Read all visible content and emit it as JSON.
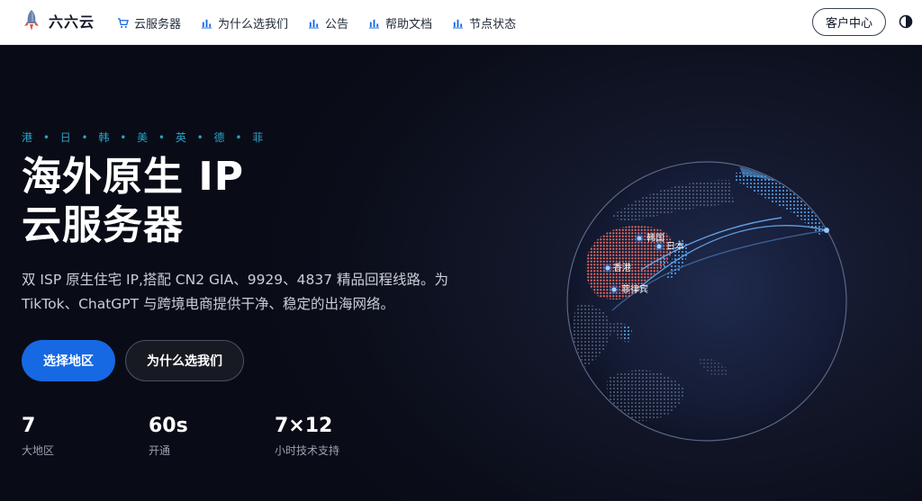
{
  "brand": {
    "name": "六六云",
    "icon": "rocket-icon"
  },
  "nav": [
    {
      "label": "云服务器",
      "icon": "cart-icon"
    },
    {
      "label": "为什么选我们",
      "icon": "bar-chart-icon"
    },
    {
      "label": "公告",
      "icon": "bar-chart-icon"
    },
    {
      "label": "帮助文档",
      "icon": "bar-chart-icon"
    },
    {
      "label": "节点状态",
      "icon": "bar-chart-icon"
    }
  ],
  "header": {
    "client_center": "客户中心",
    "theme_icon": "contrast-icon"
  },
  "hero": {
    "regions": "港 • 日 • 韩 • 美 • 英 • 德 • 菲",
    "title_line1": "海外原生 IP",
    "title_line2": "云服务器",
    "description": "双 ISP 原生住宅 IP,搭配 CN2 GIA、9929、4837 精品回程线路。为 TikTok、ChatGPT 与跨境电商提供干净、稳定的出海网络。",
    "primary_button": "选择地区",
    "secondary_button": "为什么选我们",
    "stats": [
      {
        "value": "7",
        "label": "大地区"
      },
      {
        "value": "60s",
        "label": "开通"
      },
      {
        "value": "7×12",
        "label": "小时技术支持"
      }
    ]
  },
  "globe": {
    "labels": [
      "韩国",
      "日本",
      "香港",
      "菲律宾"
    ],
    "colors": {
      "accent": "#1668e3",
      "china": "#e06a62",
      "land": "#5aa9f0"
    }
  }
}
